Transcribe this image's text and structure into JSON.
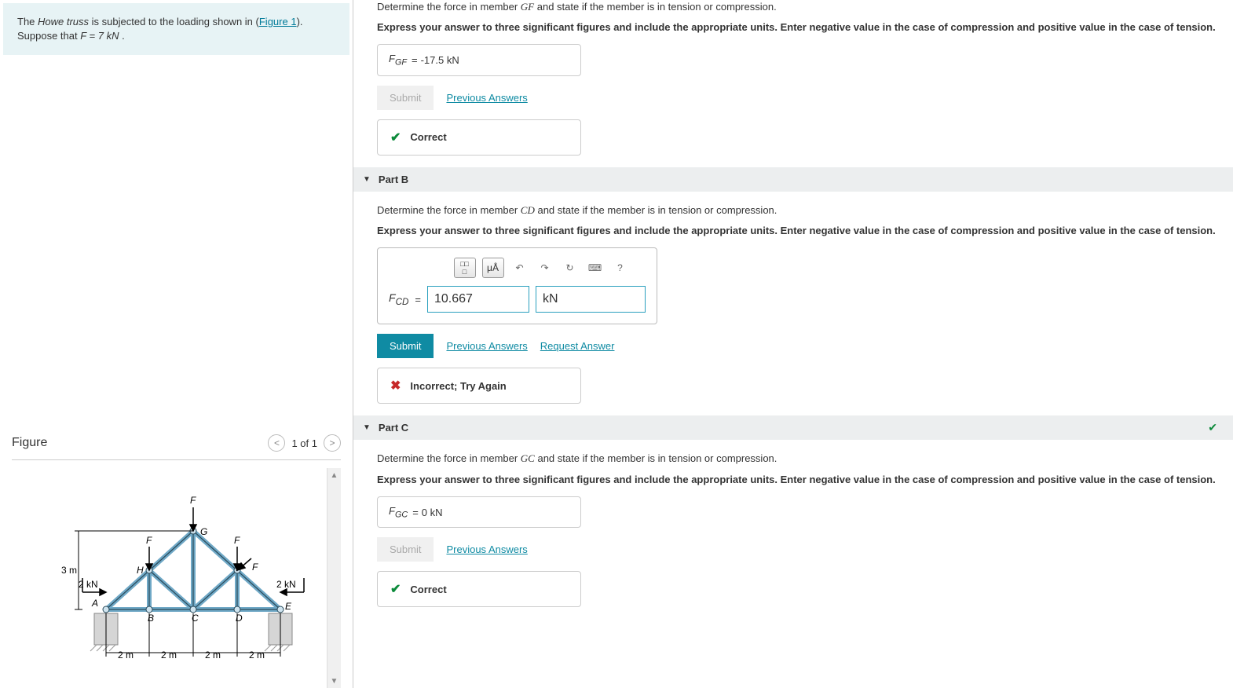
{
  "problem": {
    "text_prefix": "The ",
    "howe_truss": "Howe truss",
    "text_mid": " is subjected to the loading shown in (",
    "figure_link": "Figure 1",
    "text_after": "). Suppose that ",
    "equation": "F = 7  kN",
    "period": " ."
  },
  "figure": {
    "title": "Figure",
    "pager": "1 of 1"
  },
  "figure_labels": {
    "F_top": "F",
    "G": "G",
    "F_left": "F",
    "F_right": "F",
    "H": "H",
    "F_inner": "F",
    "height": "3 m",
    "side_load": "2 kN",
    "side_load_r": "2 kN",
    "A": "A",
    "B": "B",
    "C": "C",
    "D": "D",
    "E": "E",
    "span1": "2 m",
    "span2": "2 m",
    "span3": "2 m",
    "span4": "2 m"
  },
  "partA": {
    "question": "Determine the force in member GF and state if the member is in tension or compression.",
    "instructions": "Express your answer to three significant figures and include the appropriate units. Enter negative value in the case of compression and positive value in the case of tension.",
    "var_label": "F",
    "var_sub": "GF",
    "equals": " = ",
    "value": " -17.5 kN",
    "submit": "Submit",
    "prev": "Previous Answers",
    "feedback": "Correct"
  },
  "partB": {
    "title": "Part B",
    "question": "Determine the force in member CD and state if the member is in tension or compression.",
    "instructions": "Express your answer to three significant figures and include the appropriate units. Enter negative value in the case of compression and positive value in the case of tension.",
    "var_label": "F",
    "var_sub": "CD",
    "equals": " = ",
    "value": "10.667",
    "unit": "kN",
    "submit": "Submit",
    "prev": "Previous Answers",
    "request": "Request Answer",
    "feedback": "Incorrect; Try Again",
    "toolbar": {
      "templates": "▯▯",
      "units": "μÅ",
      "undo": "↶",
      "redo": "↷",
      "reset": "↻",
      "keyboard": "⌨",
      "help": "?"
    }
  },
  "partC": {
    "title": "Part C",
    "question": "Determine the force in member GC and state if the member is in tension or compression.",
    "instructions": "Express your answer to three significant figures and include the appropriate units. Enter negative value in the case of compression and positive value in the case of tension.",
    "var_label": "F",
    "var_sub": "GC",
    "equals": " = ",
    "value": " 0 kN",
    "submit": "Submit",
    "prev": "Previous Answers",
    "feedback": "Correct"
  }
}
